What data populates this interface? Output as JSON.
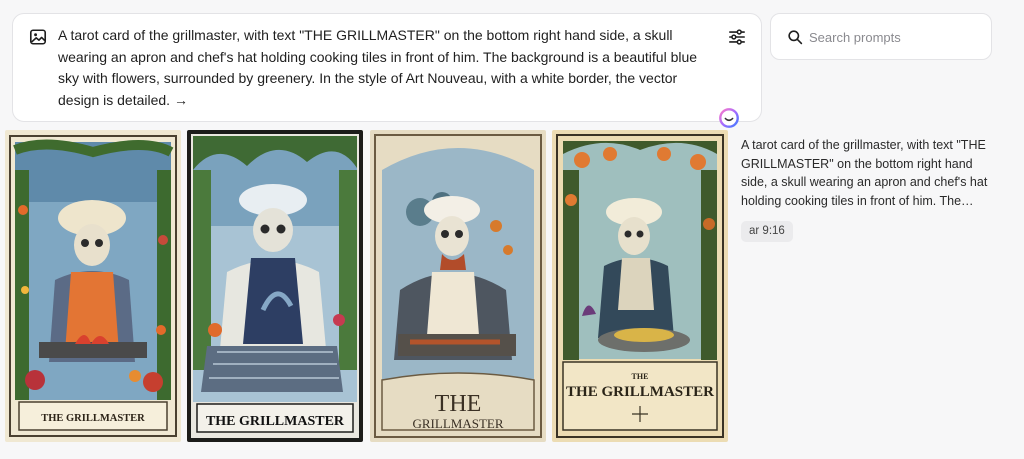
{
  "prompt": {
    "text": "A tarot card of the grillmaster, with text \"THE GRILLMASTER\" on the bottom right hand side, a skull wearing an apron and chef's hat holding cooking tiles in front of him. The background is a beautiful blue sky with flowers, surrounded by greenery. In the style of Art Nouveau, with a white border, the vector design is detailed. →",
    "image_icon": "image-icon",
    "settings_icon": "sliders-icon"
  },
  "search": {
    "placeholder": "Search prompts",
    "value": ""
  },
  "results": {
    "description": "A tarot card of the grillmaster, with text \"THE GRILLMASTER\" on the bottom right hand side, a skull wearing an apron and chef's hat holding cooking tiles in front of him. The background is a beautiful blue sky with flowers, surrounded by greenery. In the style of Art Nouveau, with a white border, the vector design is detailed.",
    "aspect_ratio": "ar 9:16",
    "images": [
      {
        "caption": "THE GRILLMASTER"
      },
      {
        "caption": "THE GRILLMASTER"
      },
      {
        "caption_line1": "THE",
        "caption_line2": "GRILLMASTER"
      },
      {
        "caption_small": "THE",
        "caption": "THE GRILLMASTER"
      }
    ]
  },
  "colors": {
    "page_bg": "#f7f7f8",
    "panel_border": "#e3e3e6",
    "badge_bg": "#ebebed",
    "ai_gradient_start": "#ff7ac6",
    "ai_gradient_end": "#3d7bff"
  }
}
